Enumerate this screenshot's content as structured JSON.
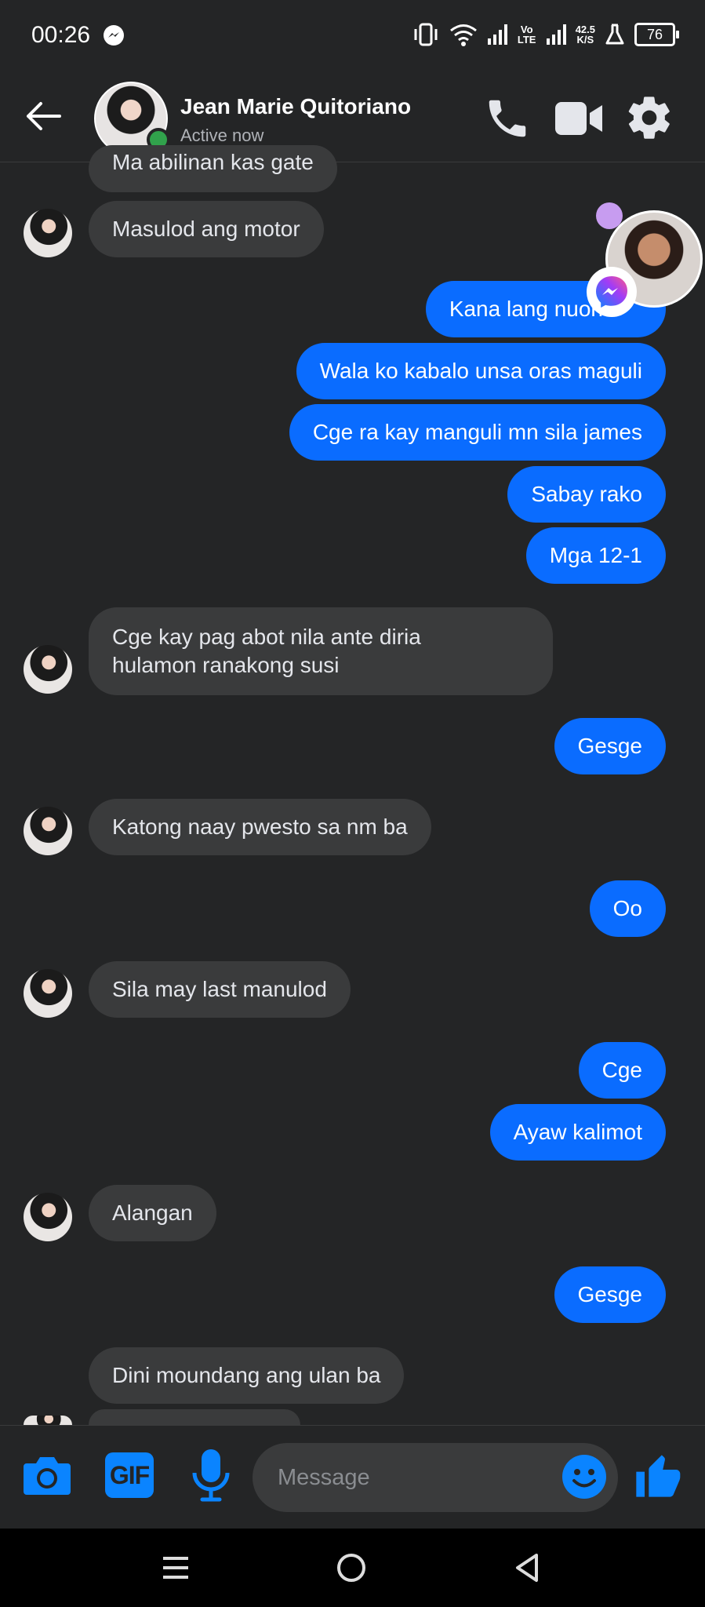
{
  "status_bar": {
    "time": "00:26",
    "lte": "Vo LTE",
    "speed_value": "42.5",
    "speed_unit": "K/S",
    "battery": "76"
  },
  "header": {
    "contact_name": "Jean Marie Quitoriano",
    "contact_status": "Active now",
    "icons": [
      "back-arrow-icon",
      "phone-icon",
      "video-camera-icon",
      "gear-icon"
    ]
  },
  "messages": [
    {
      "side": "in",
      "text": "Ma abilinan kas gate"
    },
    {
      "side": "in",
      "text": "Masulod ang motor"
    },
    {
      "side": "out",
      "text": "Kana lang nuon"
    },
    {
      "side": "out",
      "text": "Wala ko kabalo unsa oras maguli"
    },
    {
      "side": "out",
      "text": "Cge ra kay manguli mn sila james"
    },
    {
      "side": "out",
      "text": "Sabay rako"
    },
    {
      "side": "out",
      "text": "Mga 12-1"
    },
    {
      "side": "in",
      "text": "Cge kay pag abot nila ante diria",
      "text2": "hulamon ranakong susi"
    },
    {
      "side": "out",
      "text": "Gesge"
    },
    {
      "side": "in",
      "text": "Katong naay pwesto sa nm ba"
    },
    {
      "side": "out",
      "text": "Oo"
    },
    {
      "side": "in",
      "text": "Sila may last manulod"
    },
    {
      "side": "out",
      "text": "Cge"
    },
    {
      "side": "out",
      "text": "Ayaw kalimot"
    },
    {
      "side": "in",
      "text": "Alangan"
    },
    {
      "side": "out",
      "text": "Gesge"
    },
    {
      "side": "in",
      "text": "Dini moundang ang ulan ba"
    }
  ],
  "composer": {
    "placeholder": "Message",
    "gif_label": "GIF",
    "icons": [
      "camera-icon",
      "microphone-icon",
      "emoji-icon",
      "thumbs-up-icon"
    ]
  },
  "colors": {
    "background": "#242526",
    "incoming_bubble": "#3a3b3c",
    "outgoing_bubble": "#0a6cff",
    "accent": "#0a84ff",
    "online": "#31a24c"
  }
}
